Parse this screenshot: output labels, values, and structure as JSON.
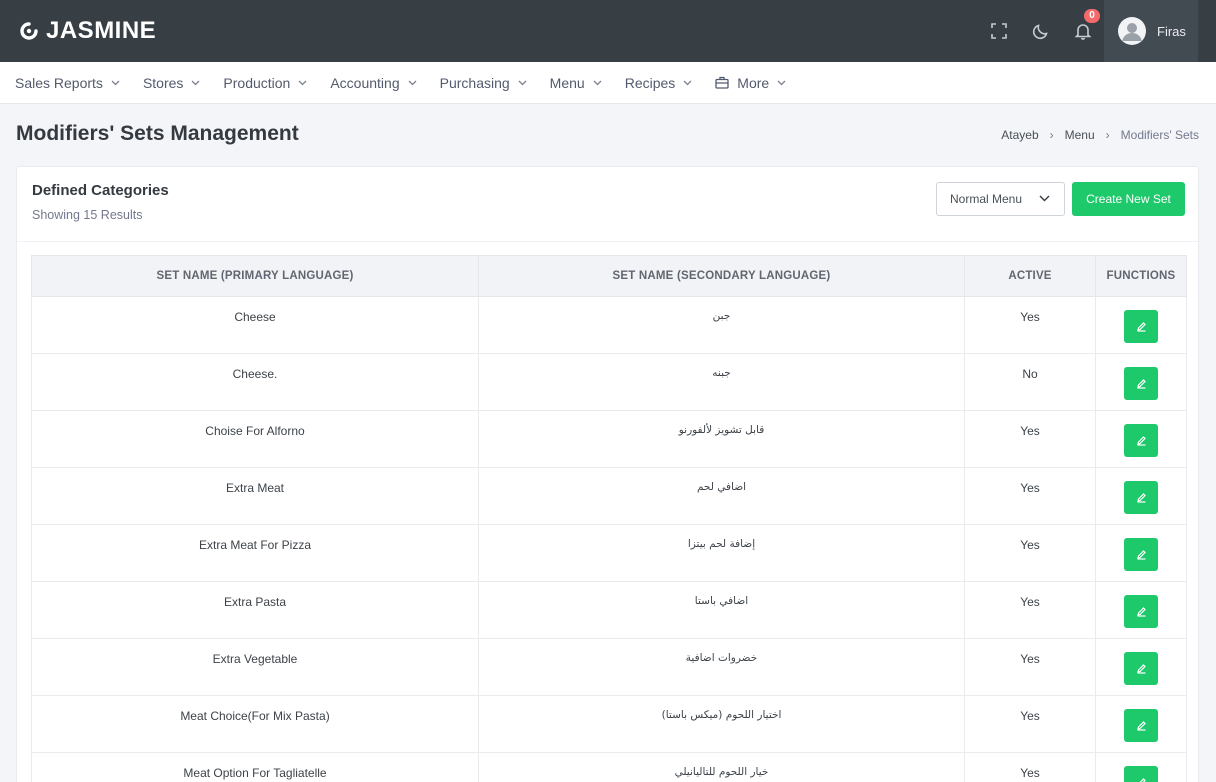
{
  "app": {
    "logo_text": "JASMINE"
  },
  "topbar": {
    "notification_count": "0",
    "user_name": "Firas"
  },
  "nav": [
    {
      "label": "Sales Reports"
    },
    {
      "label": "Stores"
    },
    {
      "label": "Production"
    },
    {
      "label": "Accounting"
    },
    {
      "label": "Purchasing"
    },
    {
      "label": "Menu"
    },
    {
      "label": "Recipes"
    },
    {
      "label": "More"
    }
  ],
  "page": {
    "title": "Modifiers' Sets Management"
  },
  "breadcrumb": [
    "Atayeb",
    "Menu",
    "Modifiers' Sets"
  ],
  "card": {
    "title": "Defined Categories",
    "subtitle": "Showing 15 Results",
    "select_value": "Normal Menu",
    "create_label": "Create New Set"
  },
  "table": {
    "headers": [
      "SET NAME (PRIMARY LANGUAGE)",
      "SET NAME (SECONDARY LANGUAGE)",
      "ACTIVE",
      "FUNCTIONS"
    ],
    "rows": [
      {
        "primary": "Cheese",
        "secondary": "جبن",
        "active": "Yes"
      },
      {
        "primary": "Cheese.",
        "secondary": "جبنه",
        "active": "No"
      },
      {
        "primary": "Choise For Alforno",
        "secondary": "قابل تشويز لألفورنو",
        "active": "Yes"
      },
      {
        "primary": "Extra Meat",
        "secondary": "اضافي لحم",
        "active": "Yes"
      },
      {
        "primary": "Extra Meat For Pizza",
        "secondary": "إضافة لحم بيتزا",
        "active": "Yes"
      },
      {
        "primary": "Extra Pasta",
        "secondary": "اضافي باستا",
        "active": "Yes"
      },
      {
        "primary": "Extra Vegetable",
        "secondary": "خضروات اضافية",
        "active": "Yes"
      },
      {
        "primary": "Meat Choice(For Mix Pasta)",
        "secondary": "اختيار اللحوم (ميكس باستا)",
        "active": "Yes"
      },
      {
        "primary": "Meat Option For Tagliatelle",
        "secondary": "خيار اللحوم للتاليانيلي",
        "active": "Yes"
      }
    ]
  },
  "colors": {
    "topbar": "#373f45",
    "accent_green": "#1dc96a",
    "badge_red": "#f46a6a"
  },
  "icons": {
    "fullscreen": "fullscreen-icon",
    "theme": "moon-icon",
    "notifications": "bell-icon",
    "edit": "pencil-icon",
    "more": "briefcase-icon"
  }
}
